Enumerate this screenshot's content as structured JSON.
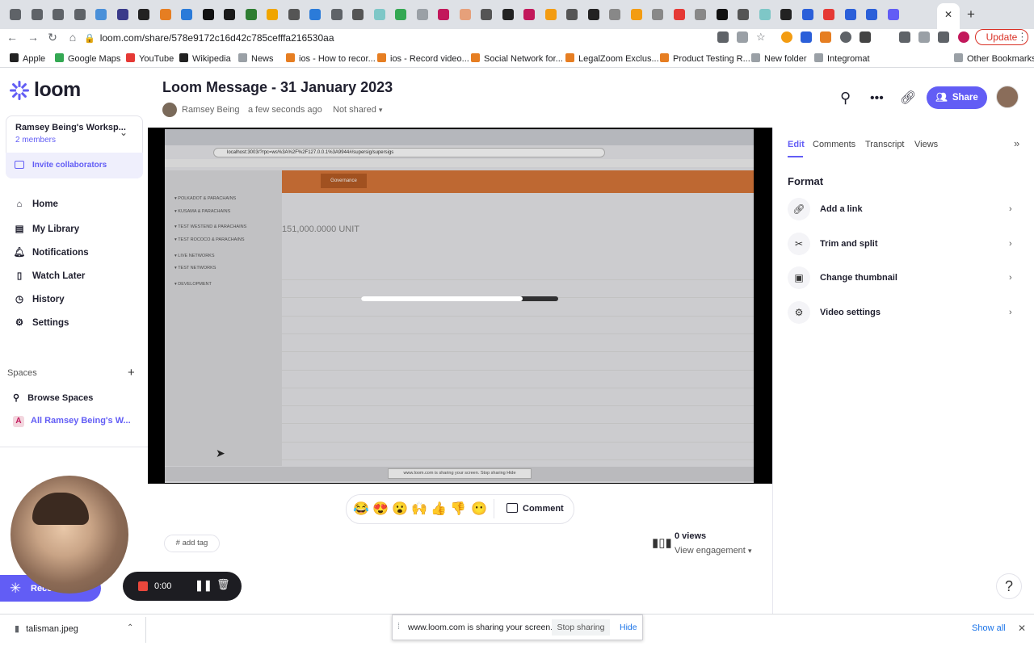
{
  "browser": {
    "url": "loom.com/share/578e9172c16d42c785cefffa216530aa",
    "update_label": "Update",
    "tab_icon_colors": [
      "#5f6368",
      "#5f6368",
      "#5f6368",
      "#5f6368",
      "#4a90d9",
      "#3a3a8a",
      "#222",
      "#e67e22",
      "#2b7bd9",
      "#111",
      "#1a1a1a",
      "#2e7d32",
      "#f0a500",
      "#555",
      "#2b7bd9",
      "#5f6368",
      "#555",
      "#7ec7c7",
      "#34a853",
      "#9aa0a6",
      "#c2185b",
      "#e6a07a",
      "#555",
      "#222",
      "#c2185b",
      "#f39c12",
      "#555",
      "#222",
      "#888",
      "#f39c12",
      "#888",
      "#e53935",
      "#888",
      "#111",
      "#555",
      "#7ec7c7",
      "#222",
      "#2b5fd9",
      "#e53935",
      "#2b5fd9",
      "#2b5fd9",
      "#625df5"
    ],
    "bookmarks": [
      {
        "label": "Apple",
        "icon": "apple-icon"
      },
      {
        "label": "Google Maps",
        "icon": "maps-icon"
      },
      {
        "label": "YouTube",
        "icon": "youtube-icon"
      },
      {
        "label": "Wikipedia",
        "icon": "wikipedia-icon"
      },
      {
        "label": "News",
        "icon": "folder-icon"
      },
      {
        "label": "ios - How to recor...",
        "icon": "bookmark-icon"
      },
      {
        "label": "ios - Record video...",
        "icon": "bookmark-icon"
      },
      {
        "label": "Social Network for...",
        "icon": "bookmark-icon"
      },
      {
        "label": "LegalZoom Exclus...",
        "icon": "bookmark-icon"
      },
      {
        "label": "Product Testing R...",
        "icon": "bookmark-icon"
      },
      {
        "label": "New folder",
        "icon": "folder-icon"
      },
      {
        "label": "Integromat",
        "icon": "folder-icon"
      },
      {
        "label": "Other Bookmarks",
        "icon": "folder-icon"
      }
    ]
  },
  "sidebar": {
    "logo": "loom",
    "workspace_name": "Ramsey Being's Worksp...",
    "workspace_members": "2 members",
    "invite_label": "Invite collaborators",
    "nav": [
      {
        "label": "Home",
        "icon": "home-icon"
      },
      {
        "label": "My Library",
        "icon": "library-icon"
      },
      {
        "label": "Notifications",
        "icon": "bell-icon"
      },
      {
        "label": "Watch Later",
        "icon": "bookmark-icon"
      },
      {
        "label": "History",
        "icon": "clock-icon"
      },
      {
        "label": "Settings",
        "icon": "gear-icon"
      }
    ],
    "spaces_header": "Spaces",
    "browse_spaces": "Browse Spaces",
    "all_workspace": "All Ramsey Being's W...",
    "all_workspace_badge": "A"
  },
  "header": {
    "title": "Loom Message - 31 January 2023",
    "owner": "Ramsey Being",
    "timestamp": "a few seconds ago",
    "share_state": "Not shared",
    "share_label": "Share"
  },
  "video": {
    "progress": 0.82,
    "inner_url": "localhost:3003/?rpc=ws%3A%2F%2F127.0.0.1%3A9944#/supersig/supersigs",
    "inner_tab": "Governance",
    "inner_funds": "151,000.0000 UNIT",
    "inner_networks": [
      "POLKADOT & PARACHAINS",
      "KUSAMA & PARACHAINS",
      "TEST WESTEND & PARACHAINS",
      "TEST ROCOCO & PARACHAINS",
      "LIVE NETWORKS",
      "TEST NETWORKS",
      "DEVELOPMENT"
    ],
    "inner_share_notice": "www.loom.com is sharing your screen.   Stop sharing   Hide"
  },
  "reactions": {
    "emojis": [
      "😂",
      "😍",
      "😮",
      "🙌",
      "👍",
      "👎",
      "😶"
    ],
    "comment_label": "Comment"
  },
  "tag": {
    "label": "add tag"
  },
  "stats": {
    "views": "0 views",
    "engagement": "View engagement"
  },
  "panel": {
    "tabs": [
      "Edit",
      "Comments",
      "Transcript",
      "Views"
    ],
    "active_tab": "Edit",
    "format_header": "Format",
    "items": [
      {
        "label": "Add a link",
        "icon": "link-icon"
      },
      {
        "label": "Trim and split",
        "icon": "scissors-icon"
      },
      {
        "label": "Change thumbnail",
        "icon": "image-icon"
      },
      {
        "label": "Video settings",
        "icon": "gear-icon"
      }
    ]
  },
  "recorder": {
    "label": "Recor...",
    "time": "0:00"
  },
  "downloads": {
    "file": "talisman.jpeg",
    "share_notice": "www.loom.com is sharing your screen.",
    "stop_sharing": "Stop sharing",
    "hide": "Hide",
    "show_all": "Show all"
  },
  "colors": {
    "accent": "#625df5",
    "record": "#e8473c"
  }
}
